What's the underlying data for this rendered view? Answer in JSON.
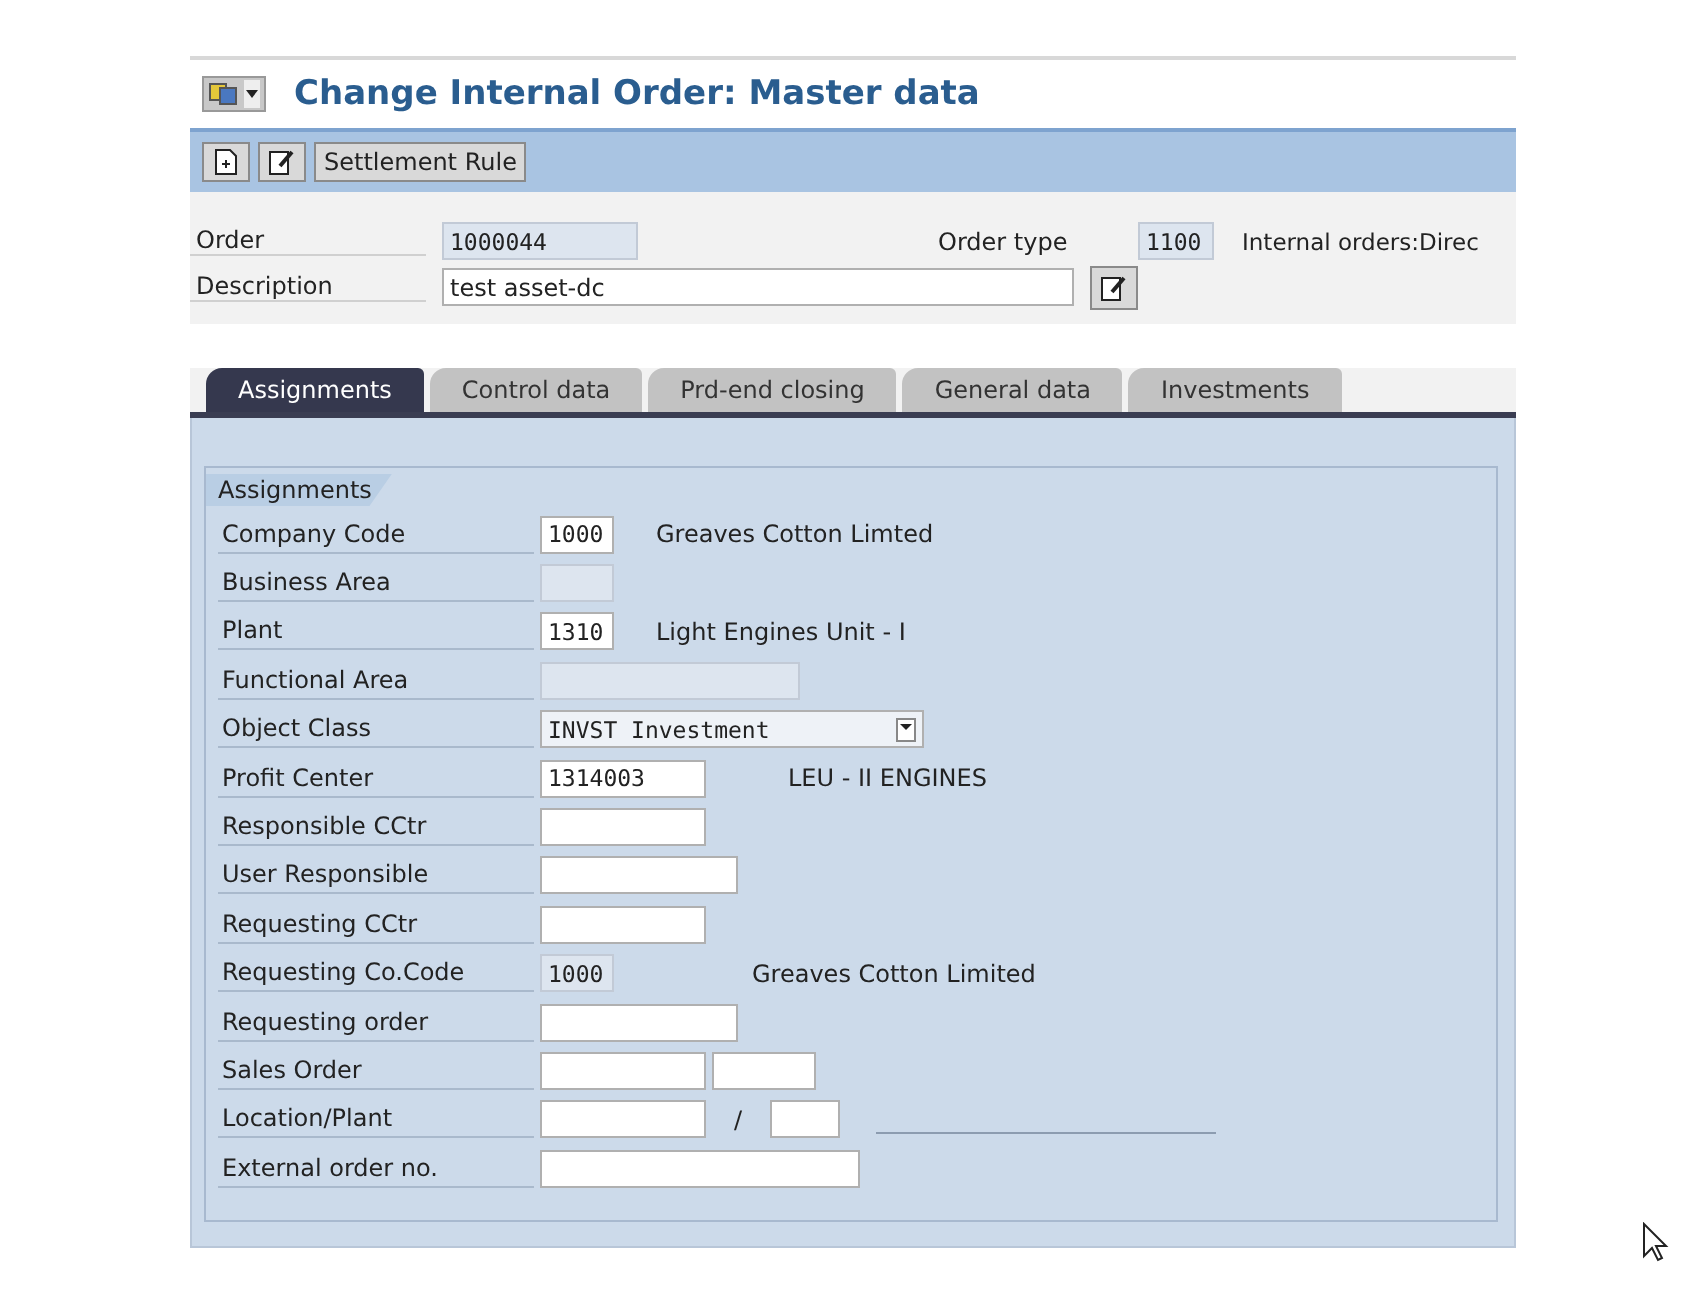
{
  "window": {
    "title": "Change Internal Order: Master data"
  },
  "toolbar": {
    "buttons": [
      {
        "kind": "icon"
      },
      {
        "kind": "icon"
      },
      {
        "kind": "text",
        "label": "Settlement Rule"
      }
    ]
  },
  "header": {
    "order": {
      "label": "Order",
      "value": "1000044",
      "editable": false
    },
    "order_type": {
      "label": "Order type",
      "value": "1100",
      "editable": false,
      "description": "Internal orders:Direc"
    },
    "description": {
      "label": "Description",
      "value": "test asset-dc",
      "editable": true
    }
  },
  "tabs": [
    {
      "label": "Assignments",
      "selected": true
    },
    {
      "label": "Control data",
      "selected": false
    },
    {
      "label": "Prd-end closing",
      "selected": false
    },
    {
      "label": "General data",
      "selected": false
    },
    {
      "label": "Investments",
      "selected": false
    }
  ],
  "group": {
    "title": "Assignments",
    "rows": [
      {
        "label": "Company Code",
        "fields": [
          {
            "kind": "input",
            "value": "1000",
            "editable": true
          }
        ],
        "description": "Greaves Cotton Limted"
      },
      {
        "label": "Business Area",
        "fields": [
          {
            "kind": "input",
            "editable": false
          }
        ]
      },
      {
        "label": "Plant",
        "fields": [
          {
            "kind": "input",
            "value": "1310",
            "editable": true
          }
        ],
        "description": "Light Engines Unit - I"
      },
      {
        "label": "Functional Area",
        "fields": [
          {
            "kind": "input",
            "editable": false
          }
        ]
      },
      {
        "label": "Object Class",
        "fields": [
          {
            "kind": "dropdown",
            "value": "INVST Investment",
            "editable": true
          }
        ]
      },
      {
        "label": "Profit Center",
        "fields": [
          {
            "kind": "input",
            "value": "1314003",
            "editable": true
          }
        ],
        "description": "LEU - II ENGINES"
      },
      {
        "label": "Responsible CCtr",
        "fields": [
          {
            "kind": "input",
            "editable": true
          }
        ]
      },
      {
        "label": "User Responsible",
        "fields": [
          {
            "kind": "input",
            "editable": true
          }
        ]
      },
      {
        "label": "Requesting CCtr",
        "fields": [
          {
            "kind": "input",
            "editable": true
          }
        ]
      },
      {
        "label": "Requesting Co.Code",
        "fields": [
          {
            "kind": "input",
            "value": "1000",
            "editable": false
          }
        ],
        "description": "Greaves Cotton Limited"
      },
      {
        "label": "Requesting order",
        "fields": [
          {
            "kind": "input",
            "editable": true
          }
        ]
      },
      {
        "label": "Sales Order",
        "fields": [
          {
            "kind": "input",
            "editable": true
          },
          {
            "kind": "input",
            "editable": true
          }
        ]
      },
      {
        "label": "Location/Plant",
        "fields": [
          {
            "kind": "input",
            "editable": true
          },
          {
            "kind": "separator",
            "value": "/"
          },
          {
            "kind": "input",
            "editable": true
          },
          {
            "kind": "line"
          }
        ]
      },
      {
        "label": "External order no.",
        "fields": [
          {
            "kind": "input",
            "editable": true
          }
        ]
      }
    ]
  }
}
